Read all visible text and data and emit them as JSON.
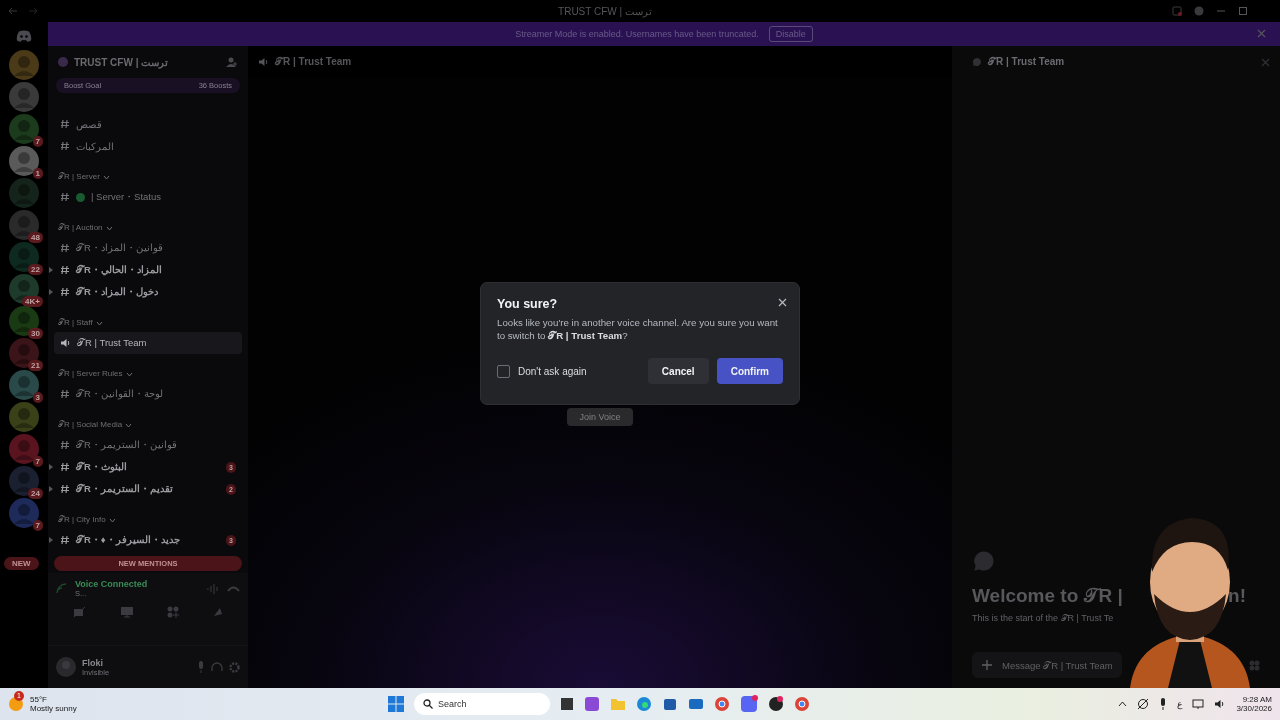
{
  "window": {
    "title": "TRUST CFW | ترست"
  },
  "banner": {
    "text": "Streamer Mode is enabled. Usernames have been truncated.",
    "button": "Disable"
  },
  "servers": [
    {
      "kind": "picture"
    },
    {
      "kind": "picture"
    },
    {
      "kind": "picture",
      "badge": "7"
    },
    {
      "kind": "picture",
      "badge": "1"
    },
    {
      "kind": "picture"
    },
    {
      "kind": "picture",
      "badge": "48"
    },
    {
      "kind": "picture",
      "badge": "22"
    },
    {
      "kind": "picture",
      "badge": "4K+"
    },
    {
      "kind": "picture",
      "badge": "30"
    },
    {
      "kind": "picture",
      "badge": "21"
    },
    {
      "kind": "picture",
      "badge": "3"
    },
    {
      "kind": "picture"
    },
    {
      "kind": "picture",
      "badge": "7"
    },
    {
      "kind": "picture",
      "badge": "24"
    },
    {
      "kind": "picture",
      "badge": "7"
    }
  ],
  "server_header": {
    "name": "TRUST CFW | ترست",
    "boost_label": "Boost Goal",
    "boost_count": "36 Boosts"
  },
  "channel_groups": [
    {
      "channels": [
        {
          "kind": "text",
          "name": "قصص",
          "unread": false,
          "selected": false
        },
        {
          "kind": "text",
          "name": "المركبات",
          "unread": false,
          "selected": false
        }
      ]
    },
    {
      "title": "𝒯R | Server",
      "channels": [
        {
          "kind": "status",
          "name": "| Server・Status",
          "unread": false,
          "selected": false
        }
      ]
    },
    {
      "title": "𝒯R | Auction",
      "channels": [
        {
          "kind": "text",
          "name": "𝒯R・قوانين・المزاد",
          "unread": false,
          "selected": false
        },
        {
          "kind": "text",
          "name": "𝒯R・المزاد・الحالي",
          "unread": true,
          "selected": false
        },
        {
          "kind": "text",
          "name": "𝒯R・دخول・المزاد",
          "unread": true,
          "selected": false
        }
      ]
    },
    {
      "title": "𝒯R | Staff",
      "channels": [
        {
          "kind": "voice",
          "name": "𝒯R | Trust Team",
          "unread": false,
          "selected": true
        }
      ]
    },
    {
      "title": "𝒯R | Server Rules",
      "channels": [
        {
          "kind": "text",
          "name": "𝒯R・لوحة・القوانين",
          "unread": false,
          "selected": false
        }
      ]
    },
    {
      "title": "𝒯R | Social Media",
      "channels": [
        {
          "kind": "text",
          "name": "𝒯R・قوانين・الستريمر",
          "unread": false,
          "selected": false
        },
        {
          "kind": "text",
          "name": "𝒯R・البثوث",
          "unread": true,
          "selected": false,
          "badge": "3"
        },
        {
          "kind": "text",
          "name": "𝒯R・تقديم・الستريمر",
          "unread": true,
          "selected": false,
          "badge": "2"
        }
      ]
    },
    {
      "title": "𝒯R | City Info",
      "channels": [
        {
          "kind": "text",
          "name": "𝒯R・♦・جديد・السيرفر",
          "unread": true,
          "selected": false,
          "badge": "3"
        }
      ]
    }
  ],
  "new_mentions": {
    "left": "NEW",
    "label": "NEW MENTIONS"
  },
  "voice_panel": {
    "status": "Voice Connected",
    "channel": "S..."
  },
  "user": {
    "name": "Floki",
    "status": "Invisible"
  },
  "channel_header": {
    "name": "𝒯R | Trust Team"
  },
  "join_button": "Join Voice",
  "dialog": {
    "title": "You sure?",
    "body": "Looks like you're in another voice channel. Are you sure you want to switch to **𝒯R | Trust Team**?",
    "checkbox": {
      "label": "Don't ask again",
      "checked": false
    },
    "cancel": "Cancel",
    "confirm": "Confirm"
  },
  "chat_panel": {
    "title": "𝒯R | Trust Team",
    "welcome_start": "Welcome to 𝒯R |",
    "welcome_end": "n!",
    "subtitle": "This is the start of the 𝒯R | Trust Te",
    "placeholder": "Message 𝒯R | Trust Team"
  },
  "taskbar": {
    "weather_badge": "1",
    "temperature": "55°F",
    "weather": "Mostly sunny",
    "search_placeholder": "Search",
    "language": "ع",
    "time": "9:28 AM",
    "date": "3/30/2026"
  }
}
